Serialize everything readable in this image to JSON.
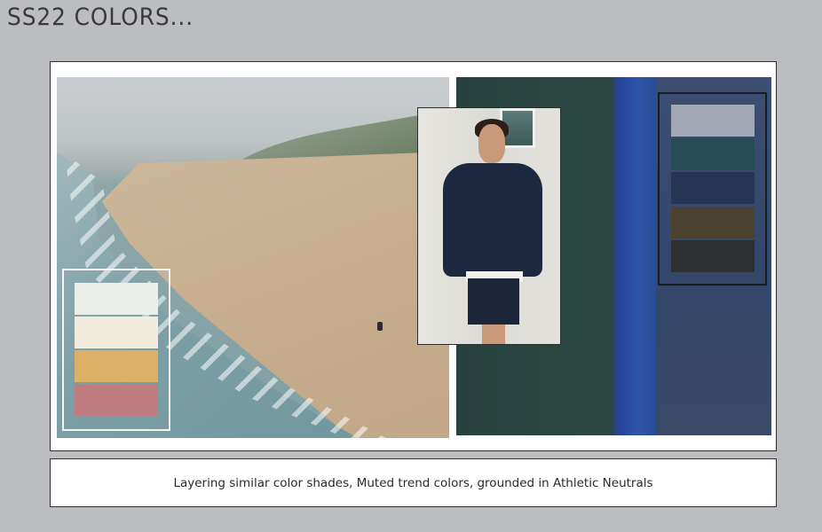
{
  "title": "SS22 COLORS...",
  "caption": "Layering similar color shades, Muted trend colors, grounded in Athletic Neutrals",
  "palette_left": [
    {
      "name": "off-white",
      "color": "#eceeea"
    },
    {
      "name": "cream",
      "color": "#f2ecdf"
    },
    {
      "name": "mustard",
      "color": "#dcb167"
    },
    {
      "name": "dusty-rose",
      "color": "#bf7e7d"
    }
  ],
  "palette_right": [
    {
      "name": "light-grey-blue",
      "color": "#a2a9b5"
    },
    {
      "name": "teal",
      "color": "#284c55"
    },
    {
      "name": "navy",
      "color": "#243653"
    },
    {
      "name": "olive-brown",
      "color": "#4a412e"
    },
    {
      "name": "charcoal",
      "color": "#2e2f31"
    }
  ],
  "colors": {
    "background": "#bcbdc0",
    "board": "#ffffff",
    "border": "#2e2e2e"
  }
}
